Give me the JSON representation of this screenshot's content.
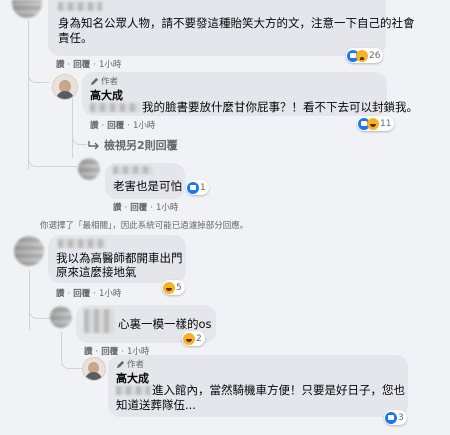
{
  "comment1": {
    "text_line1": "身為知名公眾人物，請不要發這種貽笑大方的文，注意一下自己的社會",
    "text_line2": "責任。",
    "reaction_count": "26",
    "actions": {
      "like": "讚",
      "reply": "回覆",
      "time": "1小時"
    },
    "replies": [
      {
        "badge": "作者",
        "name": "高大成",
        "text": "我的臉書要放什麼甘你屁事？！看不下去可以封鎖我。",
        "reaction_count": "11",
        "actions": {
          "like": "讚",
          "reply": "回覆",
          "time": "1小時"
        }
      }
    ],
    "view_more": "檢視另2則回覆",
    "reply2": {
      "text": "老害也是可怕",
      "reaction_count": "1",
      "actions": {
        "like": "讚",
        "reply": "回覆",
        "time": "1小時"
      }
    }
  },
  "notice": "你選擇了「最相關」，因此系統可能已過濾掉部分回應。",
  "comment2": {
    "text_line1": "我以為高醫師都開車出門",
    "text_line2": "原來這麼接地氣",
    "reaction_count": "5",
    "actions": {
      "like": "讚",
      "reply": "回覆",
      "time": "1小時"
    },
    "reply1": {
      "text": "心裏一模一樣的os",
      "reaction_count": "2",
      "actions": {
        "like": "讚",
        "reply": "回覆",
        "time": "1小時"
      }
    },
    "author_reply": {
      "badge": "作者",
      "name": "高大成",
      "text_line1": "進入館內，當然騎機車方便！只要是好日子，您也",
      "text_line2": "知道送葬隊伍...",
      "reaction_count": "3"
    }
  },
  "colors": {
    "bubble": "#e4e6eb",
    "page": "#f0f2f5",
    "like": "#1877f2",
    "haha": "#f7b125"
  }
}
